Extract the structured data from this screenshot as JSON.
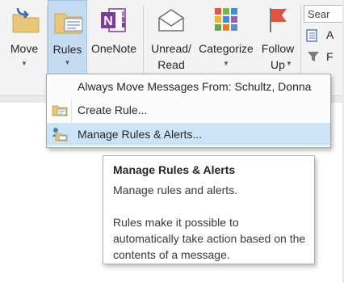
{
  "ribbon": {
    "move": {
      "label": "Move"
    },
    "rules": {
      "label": "Rules"
    },
    "onenote": {
      "label": "OneNote"
    },
    "unread": {
      "label_line1": "Unread/",
      "label_line2": "Read"
    },
    "categorize": {
      "label": "Categorize"
    },
    "followup": {
      "label_line1": "Follow",
      "label_line2": "Up"
    },
    "search": {
      "value": "Sear"
    },
    "right_letter1": "A",
    "right_letter2": "F"
  },
  "rules_menu": {
    "items": [
      {
        "label": "Always Move Messages From: Schultz, Donna"
      },
      {
        "label": "Create Rule..."
      },
      {
        "label": "Manage Rules & Alerts..."
      }
    ]
  },
  "tooltip": {
    "title": "Manage Rules & Alerts",
    "subtitle": "Manage rules and alerts.",
    "body": "Rules make it possible to automatically take action based on the contents of a message."
  },
  "colors": {
    "highlight": "#cde4f7",
    "pressed": "#c5dcf0",
    "flag": "#e0533e",
    "onenote": "#7d3b9d"
  }
}
